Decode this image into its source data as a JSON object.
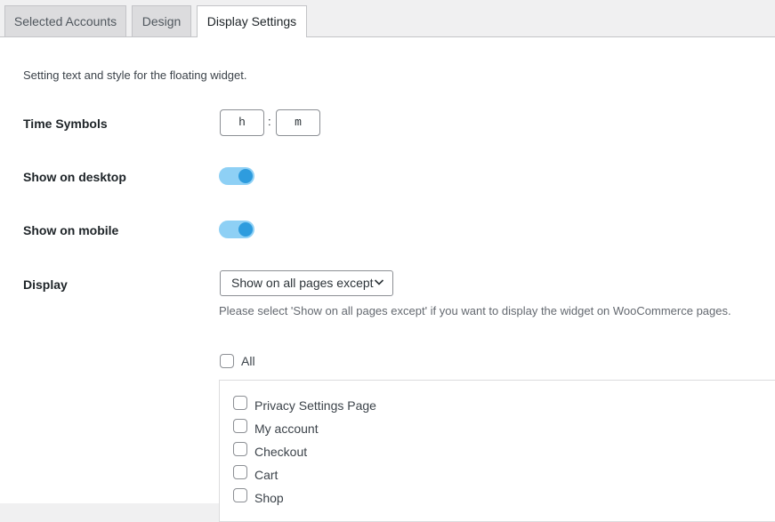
{
  "tabs": [
    {
      "label": "Selected Accounts",
      "active": false
    },
    {
      "label": "Design",
      "active": false
    },
    {
      "label": "Display Settings",
      "active": true
    }
  ],
  "intro": "Setting text and style for the floating widget.",
  "time_symbols": {
    "label": "Time Symbols",
    "hours_value": "h",
    "separator": ":",
    "minutes_value": "m"
  },
  "show_on_desktop": {
    "label": "Show on desktop",
    "enabled": true
  },
  "show_on_mobile": {
    "label": "Show on mobile",
    "enabled": true
  },
  "display": {
    "label": "Display",
    "selected": "Show on all pages except",
    "help": "Please select 'Show on all pages except' if you want to display the widget on WooCommerce pages."
  },
  "pages": {
    "all_label": "All",
    "all_checked": false,
    "items": [
      {
        "label": "Privacy Settings Page",
        "checked": false
      },
      {
        "label": "My account",
        "checked": false
      },
      {
        "label": "Checkout",
        "checked": false
      },
      {
        "label": "Cart",
        "checked": false
      },
      {
        "label": "Shop",
        "checked": false
      }
    ]
  },
  "colors": {
    "toggle_track": "#8ed0f5",
    "toggle_knob": "#2e9cde",
    "border": "#8c8f94"
  }
}
